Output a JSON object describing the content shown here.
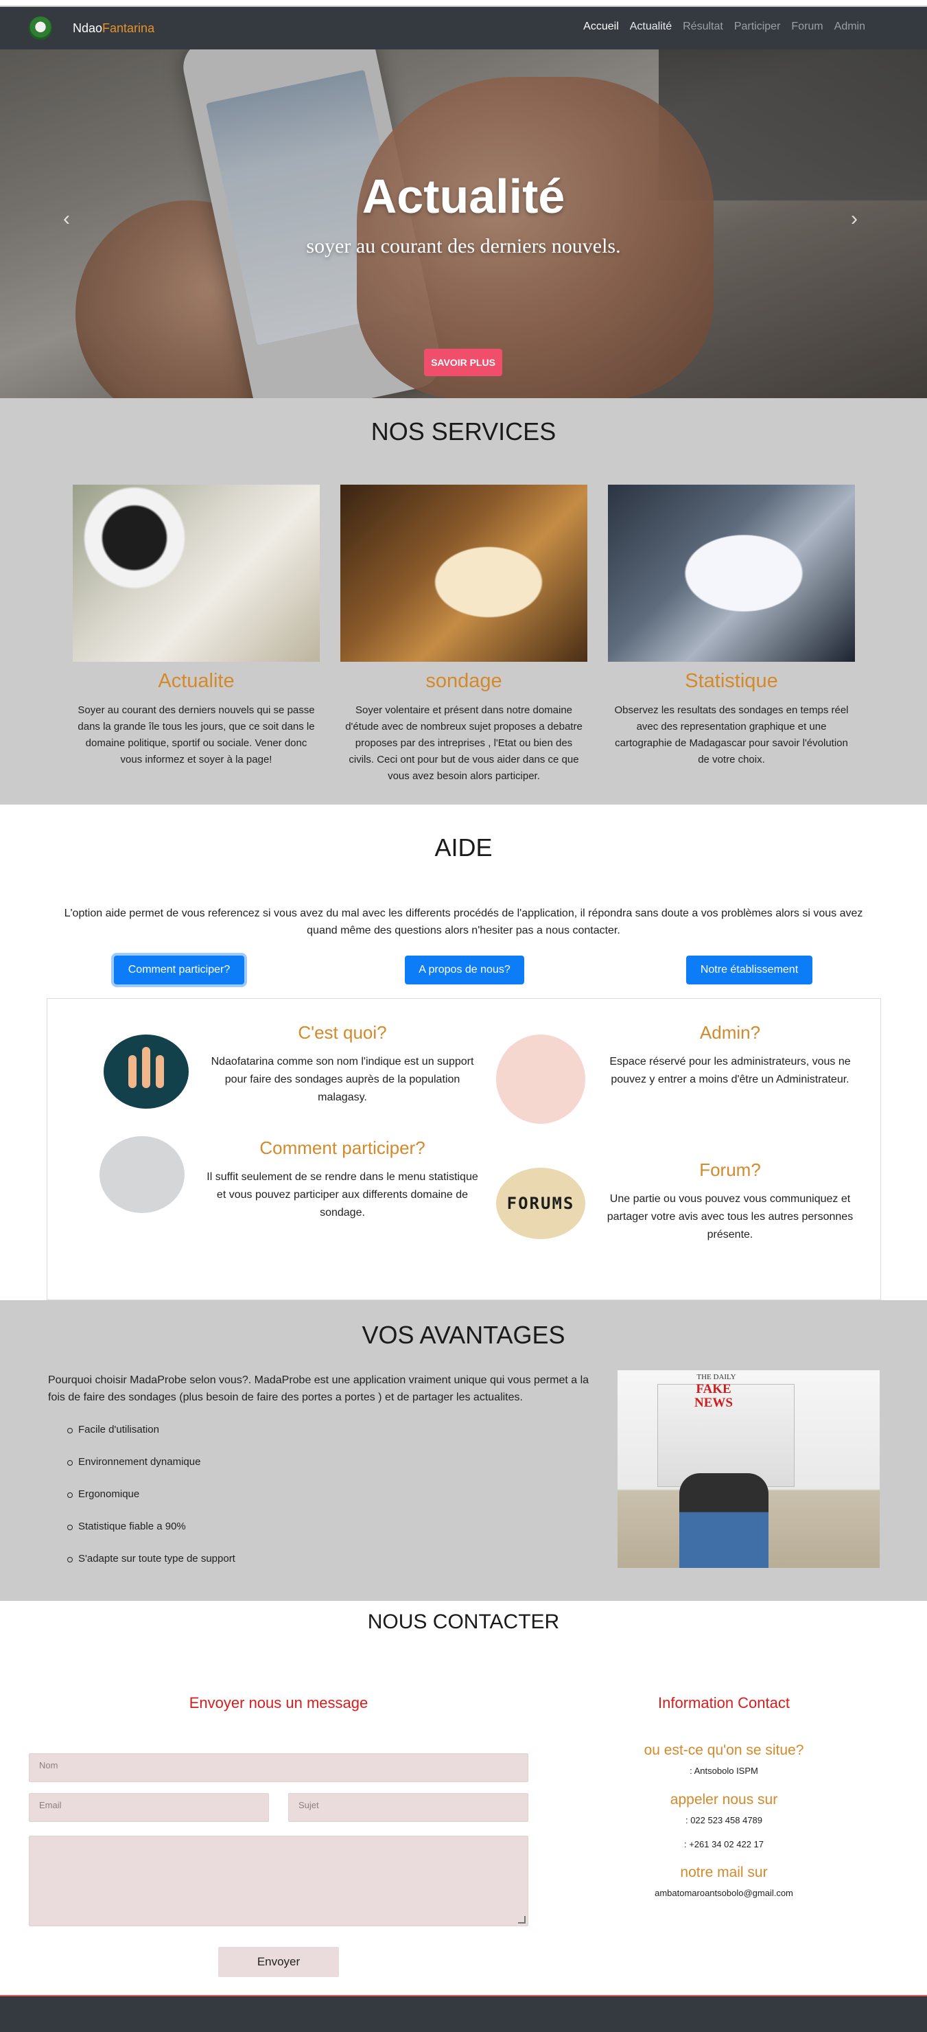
{
  "nav": {
    "brand_part1": "Ndao",
    "brand_part2": "Fantarina",
    "links": [
      "Accueil",
      "Actualité",
      "Résultat",
      "Participer",
      "Forum",
      "Admin"
    ]
  },
  "hero": {
    "title": "Actualité",
    "subtitle": "soyer au courant des derniers nouvels.",
    "button": "SAVOIR PLUS",
    "prev_icon": "‹",
    "next_icon": "›"
  },
  "services": {
    "title": "NOS SERVICES",
    "cards": [
      {
        "name": "Actualite",
        "desc": "Soyer au courant des derniers nouvels qui se passe dans la grande île tous les jours, que ce soit dans le domaine politique, sportif ou sociale. Vener donc vous informez et soyer à la page!"
      },
      {
        "name": "sondage",
        "desc": "Soyer volentaire et présent dans notre domaine d'étude avec de nombreux sujet proposes a debatre proposes par des intreprises , l'Etat ou bien des civils. Ceci ont pour but de vous aider dans ce que vous avez besoin alors participer."
      },
      {
        "name": "Statistique",
        "desc": "Observez les resultats des sondages en temps réel avec des representation graphique et une cartographie de Madagascar pour savoir l'évolution de votre choix."
      }
    ]
  },
  "aide": {
    "title": "AIDE",
    "text": "L'option aide permet de vous referencez si vous avez du mal avec les differents procédés de l'application, il répondra sans doute a vos problèmes alors si vous avez quand même des questions alors n'hesiter pas a nous contacter.",
    "buttons": [
      "Comment participer?",
      "A propos de nous?",
      "Notre établissement"
    ],
    "items": [
      {
        "title": "C'est quoi?",
        "text": "Ndaofatarina comme son nom l'indique est un support pour faire des sondages auprès de la population malagasy."
      },
      {
        "title": "Admin?",
        "text": "Espace réservé pour les administrateurs, vous ne pouvez y entrer a moins d'être un Administrateur."
      },
      {
        "title": "Comment participer?",
        "text": "Il suffit seulement de se rendre dans le menu statistique et vous pouvez participer aux differents domaine de sondage."
      },
      {
        "title": "Forum?",
        "text": "Une partie ou vous pouvez vous communiquez et partager votre avis avec tous les autres personnes présente."
      }
    ],
    "forums_word": "FORUMS"
  },
  "avantages": {
    "title": "VOS AVANTAGES",
    "intro": "Pourquoi choisir MadaProbe selon vous?. MadaProbe est une application vraiment unique qui vous permet a la fois de faire des sondages (plus besoin de faire des portes a portes ) et de partager les actualites.",
    "list": [
      "Facile d'utilisation",
      "Environnement dynamique",
      "Ergonomique",
      "Statistique fiable a 90%",
      "S'adapte sur toute type de support"
    ],
    "image_daily": "THE DAILY",
    "image_headline": "FAKE NEWS"
  },
  "contact": {
    "title": "NOUS CONTACTER",
    "form_title": "Envoyer nous un message",
    "placeholders": {
      "nom": "Nom",
      "email": "Email",
      "sujet": "Sujet"
    },
    "send": "Envoyer",
    "info_title": "Information Contact",
    "location_h": "ou est-ce qu'on se situe?",
    "location_v": ": Antsobolo ISPM",
    "phone_h": "appeler nous sur",
    "phone_1": ": 022 523 458 4789",
    "phone_2": ": +261 34 02 422 17",
    "mail_h": "notre mail sur",
    "mail_v": "ambatomaroantsobolo@gmail.com"
  },
  "colors": {
    "accent": "#d4892a",
    "primary_button": "#0d7df7",
    "hero_button": "#ef4f6a",
    "navbar": "#343a40",
    "contact_heading": "#d91c1c"
  }
}
